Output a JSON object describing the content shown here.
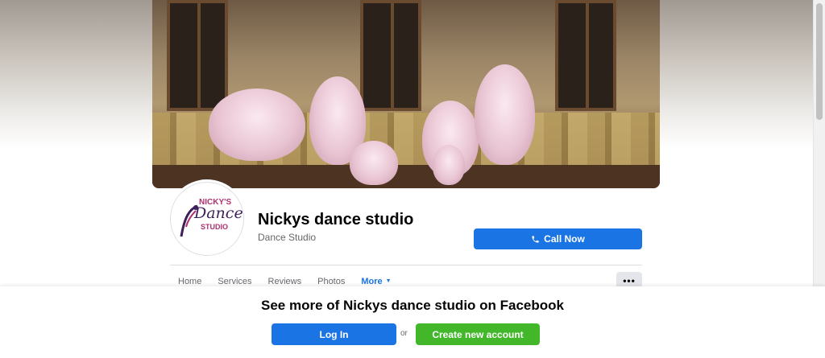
{
  "header": {
    "page_name": "Nickys dance studio",
    "category": "Dance Studio",
    "call_button_label": "Call Now",
    "call_icon": "phone-icon",
    "logo_text": {
      "line1": "NICKY'S",
      "line2": "Dance",
      "line3": "STUDIO"
    }
  },
  "nav": {
    "tabs": [
      {
        "label": "Home"
      },
      {
        "label": "Services"
      },
      {
        "label": "Reviews"
      },
      {
        "label": "Photos"
      },
      {
        "label": "More"
      }
    ],
    "overflow_label": "•••"
  },
  "login_prompt": {
    "title": "See more of Nickys dance studio on Facebook",
    "login_label": "Log In",
    "or_label": "or",
    "create_label": "Create new account"
  },
  "colors": {
    "primary_blue": "#1b74e4",
    "create_green": "#42b72a",
    "text_dark": "#050505",
    "text_muted": "#65676b"
  }
}
